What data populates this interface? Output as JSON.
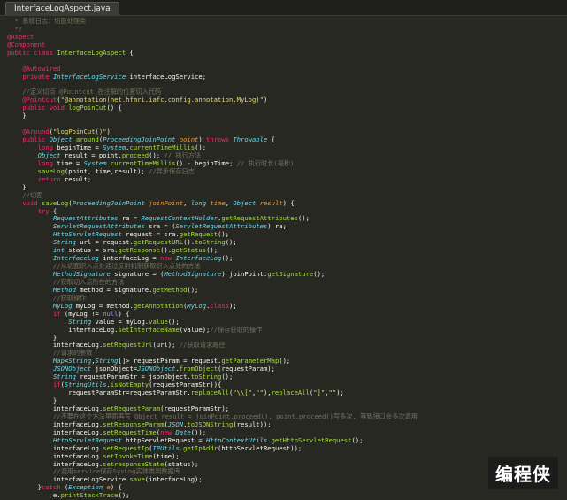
{
  "tab": {
    "label": "InterfaceLogAspect.java"
  },
  "watermark": "编程侠",
  "code_lines": [
    [
      [
        "com",
        "  * 系统日志：切面处理类"
      ]
    ],
    [
      [
        "com",
        "  */"
      ]
    ],
    [
      [
        "ann",
        "@Aspect"
      ]
    ],
    [
      [
        "ann",
        "@Component"
      ]
    ],
    [
      [
        "kw",
        "public class "
      ],
      [
        "fn",
        "InterfaceLogAspect"
      ],
      [
        "pl",
        " {"
      ]
    ],
    [
      [
        "pl",
        ""
      ]
    ],
    [
      [
        "pl",
        "    "
      ],
      [
        "ann",
        "@Autowired"
      ]
    ],
    [
      [
        "pl",
        "    "
      ],
      [
        "kw",
        "private "
      ],
      [
        "typ",
        "InterfaceLogService"
      ],
      [
        "pl",
        " interfaceLogService;"
      ]
    ],
    [
      [
        "pl",
        ""
      ]
    ],
    [
      [
        "com",
        "    //定义切点 @Pointcut 在注解的位置切入代码"
      ]
    ],
    [
      [
        "pl",
        "    "
      ],
      [
        "ann",
        "@Pointcut"
      ],
      [
        "pl",
        "("
      ],
      [
        "str",
        "\"@annotation(net.hfmri.iafc.config.annotation.MyLog)\""
      ],
      [
        "pl",
        ")"
      ]
    ],
    [
      [
        "pl",
        "    "
      ],
      [
        "kw",
        "public void "
      ],
      [
        "fn",
        "logPoinCut"
      ],
      [
        "pl",
        "() {"
      ]
    ],
    [
      [
        "pl",
        "    }"
      ]
    ],
    [
      [
        "pl",
        ""
      ]
    ],
    [
      [
        "pl",
        "    "
      ],
      [
        "ann",
        "@Around"
      ],
      [
        "pl",
        "("
      ],
      [
        "str",
        "\"logPoinCut()\""
      ],
      [
        "pl",
        ")"
      ]
    ],
    [
      [
        "pl",
        "    "
      ],
      [
        "kw",
        "public "
      ],
      [
        "typ",
        "Object"
      ],
      [
        "pl",
        " "
      ],
      [
        "fn",
        "around"
      ],
      [
        "pl",
        "("
      ],
      [
        "typ",
        "ProceedingJoinPoint"
      ],
      [
        "pl",
        " "
      ],
      [
        "par",
        "point"
      ],
      [
        "pl",
        ") "
      ],
      [
        "kw",
        "throws "
      ],
      [
        "typ",
        "Throwable"
      ],
      [
        "pl",
        " {"
      ]
    ],
    [
      [
        "pl",
        "        "
      ],
      [
        "kw",
        "long"
      ],
      [
        "pl",
        " beginTime = "
      ],
      [
        "typ",
        "System"
      ],
      [
        "pl",
        "."
      ],
      [
        "fn",
        "currentTimeMillis"
      ],
      [
        "pl",
        "();"
      ]
    ],
    [
      [
        "pl",
        "        "
      ],
      [
        "typ",
        "Object"
      ],
      [
        "pl",
        " result = point."
      ],
      [
        "fn",
        "proceed"
      ],
      [
        "pl",
        "(); "
      ],
      [
        "com",
        "// 执行方法"
      ]
    ],
    [
      [
        "pl",
        "        "
      ],
      [
        "kw",
        "long"
      ],
      [
        "pl",
        " time = "
      ],
      [
        "typ",
        "System"
      ],
      [
        "pl",
        "."
      ],
      [
        "fn",
        "currentTimeMillis"
      ],
      [
        "pl",
        "() - beginTime; "
      ],
      [
        "com",
        "// 执行时长(毫秒)"
      ]
    ],
    [
      [
        "pl",
        "        "
      ],
      [
        "fn",
        "saveLog"
      ],
      [
        "pl",
        "(point, time,result); "
      ],
      [
        "com",
        "//异步保存日志"
      ]
    ],
    [
      [
        "pl",
        "        "
      ],
      [
        "kw",
        "return"
      ],
      [
        "pl",
        " result;"
      ]
    ],
    [
      [
        "pl",
        "    }"
      ]
    ],
    [
      [
        "com",
        "    //切面"
      ]
    ],
    [
      [
        "pl",
        "    "
      ],
      [
        "kw",
        "void "
      ],
      [
        "fn",
        "saveLog"
      ],
      [
        "pl",
        "("
      ],
      [
        "typ",
        "ProceedingJoinPoint"
      ],
      [
        "pl",
        " "
      ],
      [
        "par",
        "joinPoint"
      ],
      [
        "pl",
        ", "
      ],
      [
        "typ",
        "long"
      ],
      [
        "pl",
        " "
      ],
      [
        "par",
        "time"
      ],
      [
        "pl",
        ", "
      ],
      [
        "typ",
        "Object"
      ],
      [
        "pl",
        " "
      ],
      [
        "par",
        "result"
      ],
      [
        "pl",
        ") {"
      ]
    ],
    [
      [
        "pl",
        "        "
      ],
      [
        "kw",
        "try"
      ],
      [
        "pl",
        " {"
      ]
    ],
    [
      [
        "pl",
        "            "
      ],
      [
        "typ",
        "RequestAttributes"
      ],
      [
        "pl",
        " ra = "
      ],
      [
        "typ",
        "RequestContextHolder"
      ],
      [
        "pl",
        "."
      ],
      [
        "fn",
        "getRequestAttributes"
      ],
      [
        "pl",
        "();"
      ]
    ],
    [
      [
        "pl",
        "            "
      ],
      [
        "typ",
        "ServletRequestAttributes"
      ],
      [
        "pl",
        " sra = ("
      ],
      [
        "typ",
        "ServletRequestAttributes"
      ],
      [
        "pl",
        ") ra;"
      ]
    ],
    [
      [
        "pl",
        "            "
      ],
      [
        "typ",
        "HttpServletRequest"
      ],
      [
        "pl",
        " request = sra."
      ],
      [
        "fn",
        "getRequest"
      ],
      [
        "pl",
        "();"
      ]
    ],
    [
      [
        "pl",
        "            "
      ],
      [
        "typ",
        "String"
      ],
      [
        "pl",
        " url = request."
      ],
      [
        "fn",
        "getRequestURL"
      ],
      [
        "pl",
        "()."
      ],
      [
        "fn",
        "toString"
      ],
      [
        "pl",
        "();"
      ]
    ],
    [
      [
        "pl",
        "            "
      ],
      [
        "typ",
        "int"
      ],
      [
        "pl",
        " status = sra."
      ],
      [
        "fn",
        "getResponse"
      ],
      [
        "pl",
        "()."
      ],
      [
        "fn",
        "getStatus"
      ],
      [
        "pl",
        "();"
      ]
    ],
    [
      [
        "pl",
        "            "
      ],
      [
        "typ",
        "InterfaceLog"
      ],
      [
        "pl",
        " interfaceLog = "
      ],
      [
        "kw",
        "new "
      ],
      [
        "typ",
        "InterfaceLog"
      ],
      [
        "pl",
        "();"
      ]
    ],
    [
      [
        "com",
        "            //从切面织入点处通过反射机制获取织入点处的方法"
      ]
    ],
    [
      [
        "pl",
        "            "
      ],
      [
        "typ",
        "MethodSignature"
      ],
      [
        "pl",
        " signature = ("
      ],
      [
        "typ",
        "MethodSignature"
      ],
      [
        "pl",
        ") joinPoint."
      ],
      [
        "fn",
        "getSignature"
      ],
      [
        "pl",
        "();"
      ]
    ],
    [
      [
        "com",
        "            //获取切入点所在的方法"
      ]
    ],
    [
      [
        "pl",
        "            "
      ],
      [
        "typ",
        "Method"
      ],
      [
        "pl",
        " method = signature."
      ],
      [
        "fn",
        "getMethod"
      ],
      [
        "pl",
        "();"
      ]
    ],
    [
      [
        "com",
        "            //获取操作"
      ]
    ],
    [
      [
        "pl",
        "            "
      ],
      [
        "typ",
        "MyLog"
      ],
      [
        "pl",
        " myLog = method."
      ],
      [
        "fn",
        "getAnnotation"
      ],
      [
        "pl",
        "("
      ],
      [
        "typ",
        "MyLog"
      ],
      [
        "pl",
        "."
      ],
      [
        "kw",
        "class"
      ],
      [
        "pl",
        ");"
      ]
    ],
    [
      [
        "pl",
        "            "
      ],
      [
        "kw",
        "if"
      ],
      [
        "pl",
        " (myLog != "
      ],
      [
        "bk",
        "null"
      ],
      [
        "pl",
        ") {"
      ]
    ],
    [
      [
        "pl",
        "                "
      ],
      [
        "typ",
        "String"
      ],
      [
        "pl",
        " value = myLog."
      ],
      [
        "fn",
        "value"
      ],
      [
        "pl",
        "();"
      ]
    ],
    [
      [
        "pl",
        "                interfaceLog."
      ],
      [
        "fn",
        "setInterfaceName"
      ],
      [
        "pl",
        "(value);"
      ],
      [
        "com",
        "//保存获取的操作"
      ]
    ],
    [
      [
        "pl",
        "            }"
      ]
    ],
    [
      [
        "pl",
        "            interfaceLog."
      ],
      [
        "fn",
        "setRequestUrl"
      ],
      [
        "pl",
        "(url); "
      ],
      [
        "com",
        "//获取请求路径"
      ]
    ],
    [
      [
        "com",
        "            //请求的参数"
      ]
    ],
    [
      [
        "pl",
        "            "
      ],
      [
        "typ",
        "Map"
      ],
      [
        "pl",
        "<"
      ],
      [
        "typ",
        "String"
      ],
      [
        "pl",
        ","
      ],
      [
        "typ",
        "String"
      ],
      [
        "pl",
        "[]> requestParam = request."
      ],
      [
        "fn",
        "getParameterMap"
      ],
      [
        "pl",
        "();"
      ]
    ],
    [
      [
        "pl",
        "            "
      ],
      [
        "typ",
        "JSONObject"
      ],
      [
        "pl",
        " jsonObject="
      ],
      [
        "typ",
        "JSONObject"
      ],
      [
        "pl",
        "."
      ],
      [
        "fn",
        "fromObject"
      ],
      [
        "pl",
        "(requestParam);"
      ]
    ],
    [
      [
        "pl",
        "            "
      ],
      [
        "typ",
        "String"
      ],
      [
        "pl",
        " requestParamStr = jsonObject."
      ],
      [
        "fn",
        "toString"
      ],
      [
        "pl",
        "();"
      ]
    ],
    [
      [
        "pl",
        "            "
      ],
      [
        "kw",
        "if"
      ],
      [
        "pl",
        "("
      ],
      [
        "typ",
        "StringUtils"
      ],
      [
        "pl",
        "."
      ],
      [
        "fn",
        "isNotEmpty"
      ],
      [
        "pl",
        "(requestParamStr)){"
      ]
    ],
    [
      [
        "pl",
        "                requestParamStr=requestParamStr."
      ],
      [
        "fn",
        "replaceAll"
      ],
      [
        "pl",
        "("
      ],
      [
        "str",
        "\"\\\\[\""
      ],
      [
        "pl",
        ","
      ],
      [
        "str",
        "\"\""
      ],
      [
        "pl",
        "),"
      ],
      [
        "fn",
        "replaceAll"
      ],
      [
        "pl",
        "("
      ],
      [
        "str",
        "\"]\""
      ],
      [
        "pl",
        ","
      ],
      [
        "str",
        "\"\""
      ],
      [
        "pl",
        ");"
      ]
    ],
    [
      [
        "pl",
        "            }"
      ]
    ],
    [
      [
        "pl",
        "            interfaceLog."
      ],
      [
        "fn",
        "setRequestParam"
      ],
      [
        "pl",
        "(requestParamStr);"
      ]
    ],
    [
      [
        "com",
        "            //不要在这个方法里面再写 Object result = joinPoint.proceed(), point.proceed()写多次, 等致接口会多次调用"
      ]
    ],
    [
      [
        "pl",
        "            interfaceLog."
      ],
      [
        "fn",
        "setResponseParam"
      ],
      [
        "pl",
        "("
      ],
      [
        "typ",
        "JSON"
      ],
      [
        "pl",
        "."
      ],
      [
        "fn",
        "toJSONString"
      ],
      [
        "pl",
        "(result));"
      ]
    ],
    [
      [
        "pl",
        "            interfaceLog."
      ],
      [
        "fn",
        "setRequestTime"
      ],
      [
        "pl",
        "("
      ],
      [
        "kw",
        "new "
      ],
      [
        "typ",
        "Date"
      ],
      [
        "pl",
        "());"
      ]
    ],
    [
      [
        "pl",
        "            "
      ],
      [
        "typ",
        "HttpServletRequest"
      ],
      [
        "pl",
        " httpServletRequest = "
      ],
      [
        "typ",
        "HttpContextUtils"
      ],
      [
        "pl",
        "."
      ],
      [
        "fn",
        "getHttpServletRequest"
      ],
      [
        "pl",
        "();"
      ]
    ],
    [
      [
        "pl",
        "            interfaceLog."
      ],
      [
        "fn",
        "setRequestIp"
      ],
      [
        "pl",
        "("
      ],
      [
        "typ",
        "IPUtils"
      ],
      [
        "pl",
        "."
      ],
      [
        "fn",
        "getIpAddr"
      ],
      [
        "pl",
        "(httpServletRequest));"
      ]
    ],
    [
      [
        "pl",
        "            interfaceLog."
      ],
      [
        "fn",
        "setInvokeTime"
      ],
      [
        "pl",
        "(time);"
      ]
    ],
    [
      [
        "pl",
        "            interfaceLog."
      ],
      [
        "fn",
        "setresponseState"
      ],
      [
        "pl",
        "(status);"
      ]
    ],
    [
      [
        "com",
        "            //调用service保存SysLog实体类到数据库"
      ]
    ],
    [
      [
        "pl",
        "            interfaceLogService."
      ],
      [
        "fn",
        "save"
      ],
      [
        "pl",
        "(interfaceLog);"
      ]
    ],
    [
      [
        "pl",
        "        }"
      ],
      [
        "kw",
        "catch"
      ],
      [
        "pl",
        " ("
      ],
      [
        "typ",
        "Exception"
      ],
      [
        "pl",
        " "
      ],
      [
        "par",
        "e"
      ],
      [
        "pl",
        ") {"
      ]
    ],
    [
      [
        "pl",
        "            e."
      ],
      [
        "fn",
        "printStackTrace"
      ],
      [
        "pl",
        "();"
      ]
    ],
    [
      [
        "pl",
        "        }"
      ]
    ]
  ]
}
